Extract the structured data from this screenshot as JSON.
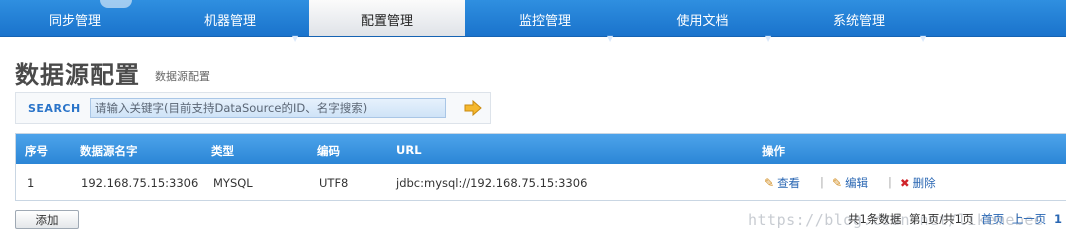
{
  "nav": {
    "items": [
      {
        "label": "同步管理",
        "has_arrow": false,
        "active": false
      },
      {
        "label": "机器管理",
        "has_arrow": true,
        "active": false
      },
      {
        "label": "配置管理",
        "has_arrow": false,
        "active": true
      },
      {
        "label": "监控管理",
        "has_arrow": true,
        "active": false
      },
      {
        "label": "使用文档",
        "has_arrow": true,
        "active": false
      },
      {
        "label": "系统管理",
        "has_arrow": true,
        "active": false
      }
    ],
    "arrow_glyph": "▼"
  },
  "page": {
    "title": "数据源配置",
    "breadcrumb": "数据源配置"
  },
  "search": {
    "label": "SEARCH",
    "placeholder": "请输入关键字(目前支持DataSource的ID、名字搜索)",
    "value": "",
    "go_icon": "arrow-right-icon"
  },
  "table": {
    "headers": {
      "seq": "序号",
      "name": "数据源名字",
      "type": "类型",
      "encoding": "编码",
      "url": "URL",
      "actions": "操作"
    },
    "rows": [
      {
        "seq": "1",
        "name": "192.168.75.15:3306",
        "type": "MYSQL",
        "encoding": "UTF8",
        "url": "jdbc:mysql://192.168.75.15:3306",
        "view": "查看",
        "edit": "编辑",
        "delete": "删除"
      }
    ],
    "separator": "|"
  },
  "footer": {
    "add_label": "添加",
    "watermark": "https://blog.csdn.net/likemebee",
    "pager": {
      "summary": "共1条数据",
      "pages": "第1页/共1页",
      "first": "首页",
      "prev": "上一页",
      "current": "1"
    }
  },
  "colors": {
    "nav_blue": "#1a73cc",
    "header_blue": "#2b86d6",
    "link_blue": "#2a67b3",
    "delete_red": "#d0242b",
    "edit_orange": "#d08a1b"
  }
}
